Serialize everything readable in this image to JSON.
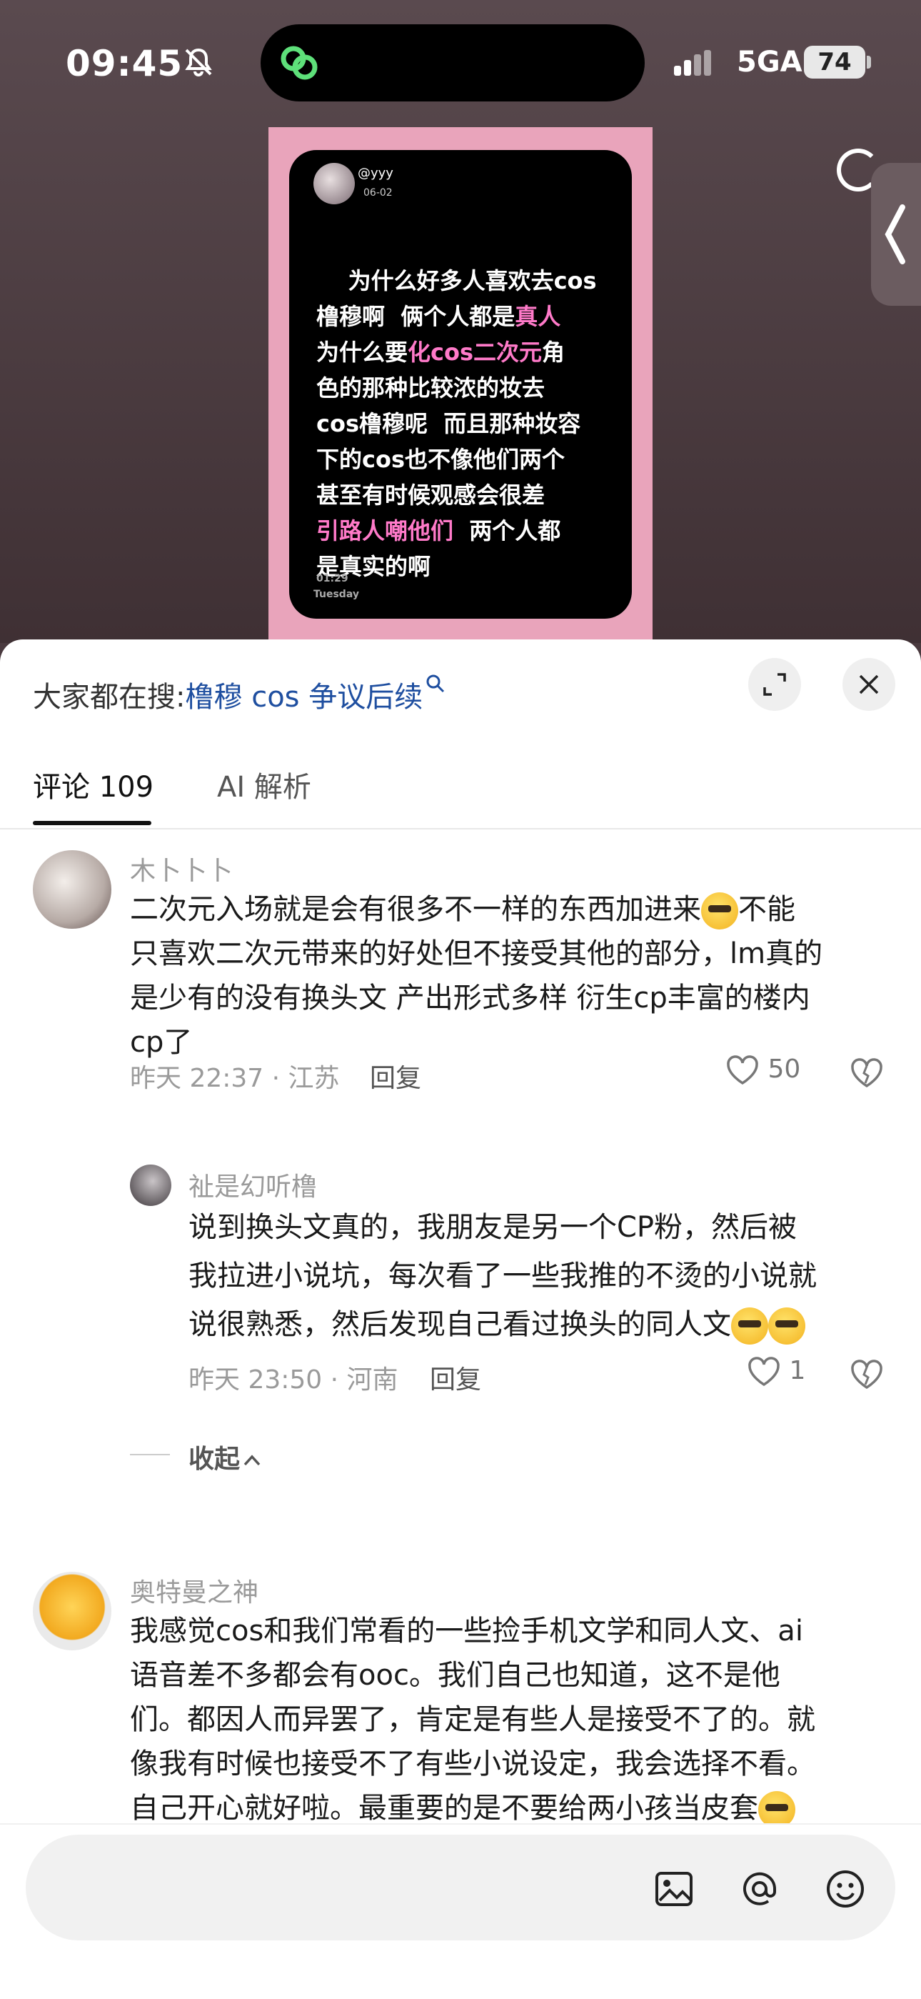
{
  "status": {
    "time": "09:45",
    "network": "5GA",
    "battery": "74"
  },
  "post": {
    "handle": "@yyy",
    "date": "06-02",
    "text_parts": [
      {
        "t": "为什么好多人喜欢去cos\n橹穆啊  俩个人都是",
        "pink": false
      },
      {
        "t": "真人",
        "pink": true
      },
      {
        "t": "\n为什么要",
        "pink": false
      },
      {
        "t": "化cos二次元",
        "pink": true
      },
      {
        "t": "角\n色的那种比较浓的妆去\ncos橹穆呢  而且那种妆容\n下的cos也不像他们两个\n甚至有时候观感会很差\n",
        "pink": false
      },
      {
        "t": "引路人嘲他们",
        "pink": true
      },
      {
        "t": "  两个人都\n是真实的啊",
        "pink": false
      }
    ],
    "time": "01:29",
    "day": "Tuesday"
  },
  "search": {
    "prefix": "大家都在搜:",
    "query": "橹穆 cos 争议后续"
  },
  "tabs": [
    {
      "label": "评论 109"
    },
    {
      "label": "AI 解析"
    }
  ],
  "comments": [
    {
      "name": "木卜卜卜",
      "text_a": "二次元入场就是会有很多不一样的东西加进来",
      "text_b": "不能\n只喜欢二次元带来的好处但不接受其他的部分，lm真的\n是少有的没有换头文 产出形式多样 衍生cp丰富的楼内\ncp了",
      "meta": "昨天 22:37 · 江苏",
      "reply": "回复",
      "likes": "50"
    },
    {
      "name": "祉是幻听橹",
      "text": "说到换头文真的，我朋友是另一个CP粉，然后被\n我拉进小说坑，每次看了一些我推的不烫的小说就\n说很熟悉，然后发现自己看过换头的同人文",
      "meta": "昨天 23:50 · 河南",
      "reply": "回复",
      "likes": "1"
    },
    {
      "name": "奥特曼之神",
      "text": "我感觉cos和我们常看的一些捡手机文学和同人文、ai\n语音差不多都会有ooc。我们自己也知道，这不是他\n们。都因人而异罢了，肯定是有些人是接受不了的。就\n像我有时候也接受不了有些小说设定，我会选择不看。\n自己开心就好啦。最重要的是不要给两小孩当皮套"
    }
  ],
  "collapse_label": "收起",
  "colors": {
    "accent_pink": "#ff7ac9",
    "link_blue": "#1f4fa0"
  }
}
